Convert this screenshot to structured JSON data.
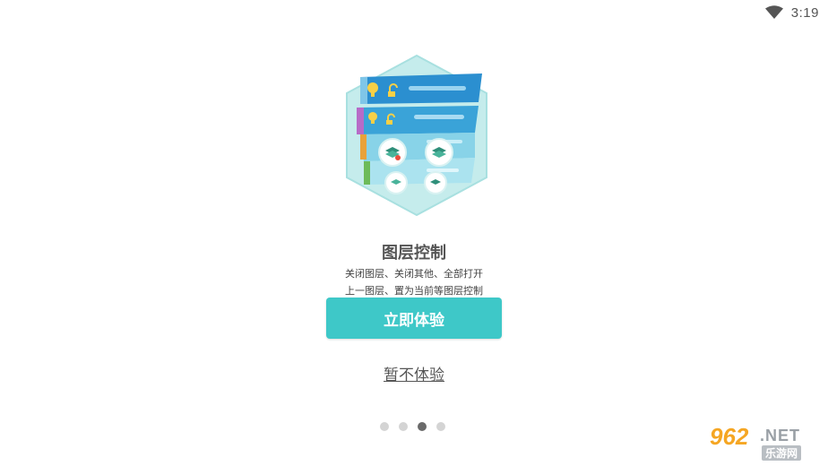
{
  "status_bar": {
    "time": "3:19",
    "wifi_icon": "wifi-icon"
  },
  "feature": {
    "illustration_icon": "layer-control-illustration",
    "title": "图层控制",
    "description_line1": "关闭图层、关闭其他、全部打开",
    "description_line2": "上一图层、置为当前等图层控制"
  },
  "actions": {
    "primary_label": "立即体验",
    "skip_label": "暂不体验"
  },
  "pager": {
    "total_pages": 4,
    "current_page": 3
  },
  "watermark": {
    "number": "962",
    "suffix": ".NET",
    "chinese": "乐游网"
  },
  "colors": {
    "accent": "#3ec8c8",
    "dot_active": "#6a6a6a",
    "dot_inactive": "#d4d4d4"
  }
}
